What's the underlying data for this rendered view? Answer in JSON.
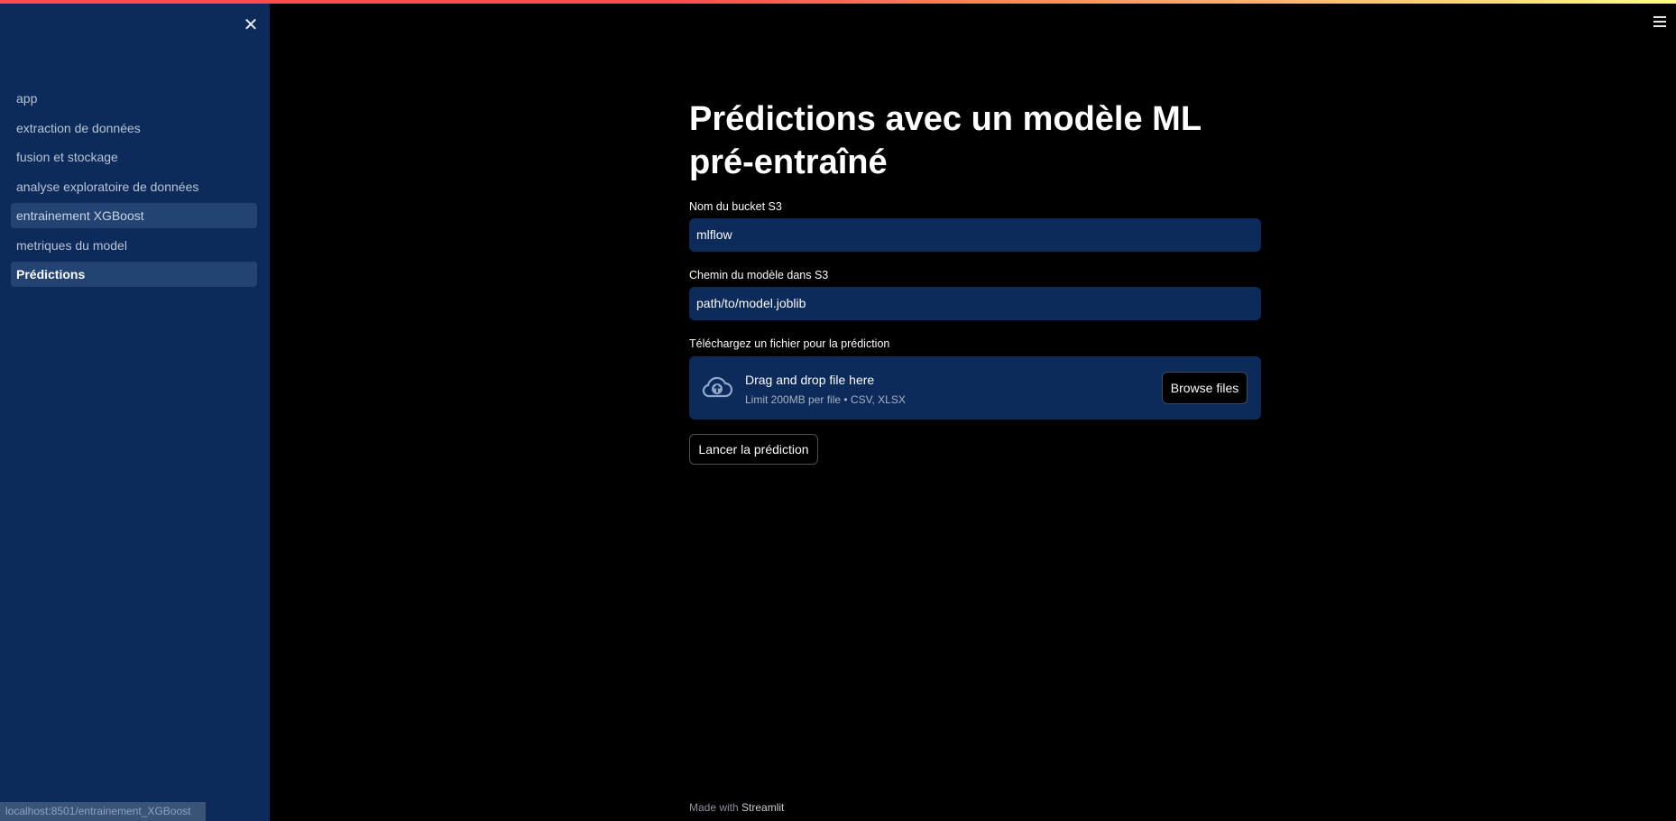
{
  "sidebar": {
    "close_icon": "close-icon",
    "items": [
      {
        "label": "app",
        "state": "normal"
      },
      {
        "label": "extraction de données",
        "state": "normal"
      },
      {
        "label": "fusion et stockage",
        "state": "normal"
      },
      {
        "label": "analyse exploratoire de données",
        "state": "normal"
      },
      {
        "label": "entrainement XGBoost",
        "state": "hover"
      },
      {
        "label": "metriques du model",
        "state": "normal"
      },
      {
        "label": "Prédictions",
        "state": "active"
      }
    ],
    "status_url": "localhost:8501/entrainement_XGBoost"
  },
  "header": {
    "menu_icon": "hamburger-menu-icon",
    "accent_gradient": [
      "#ff4b4b",
      "#fffd80"
    ]
  },
  "main": {
    "title": "Prédictions avec un modèle ML pré-entraîné",
    "bucket": {
      "label": "Nom du bucket S3",
      "value": "mlflow"
    },
    "model_path": {
      "label": "Chemin du modèle dans S3",
      "value": "path/to/model.joblib"
    },
    "uploader": {
      "label": "Téléchargez un fichier pour la prédiction",
      "icon": "cloud-upload-icon",
      "main_text": "Drag and drop file here",
      "sub_text": "Limit 200MB per file • CSV, XLSX",
      "browse_label": "Browse files"
    },
    "predict_button": "Lancer la prédiction"
  },
  "footer": {
    "made_with": "Made with",
    "brand": "Streamlit"
  },
  "colors": {
    "sidebar_bg": "#0d2b5a",
    "main_bg": "#000000",
    "input_bg": "#0d2b5a",
    "nav_selected": "#234373"
  }
}
